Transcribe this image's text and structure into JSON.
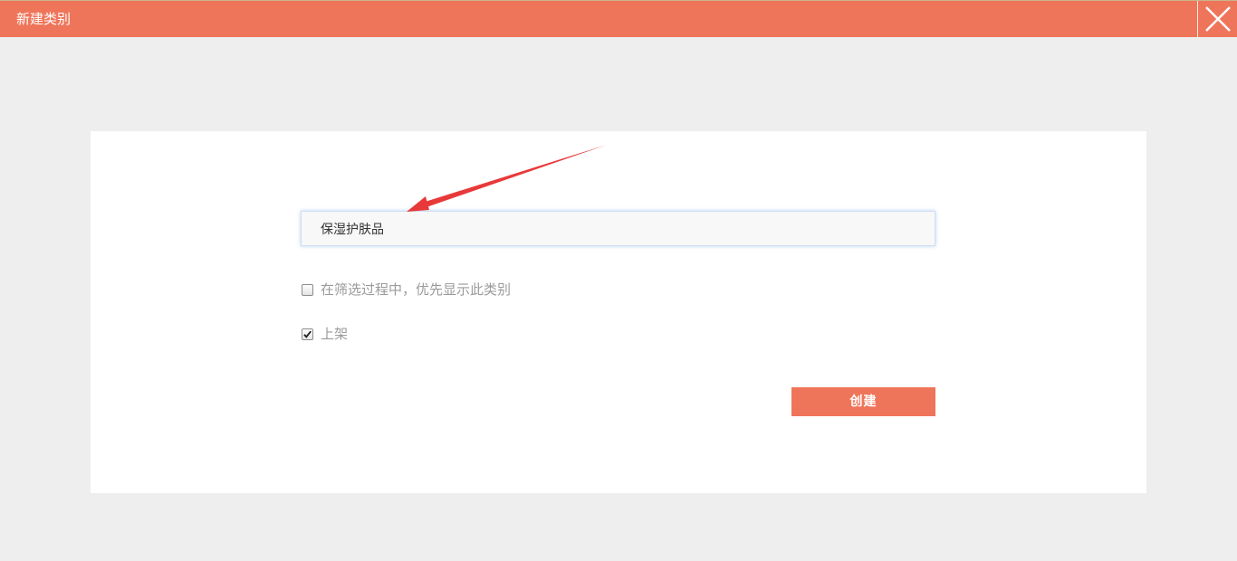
{
  "window": {
    "title": "新建类别",
    "close_icon": "close-icon",
    "accent_color": "#ef755a"
  },
  "form": {
    "category_name_value": "保湿护肤品",
    "options": [
      {
        "label": "在筛选过程中，优先显示此类别",
        "checked": false
      },
      {
        "label": "上架",
        "checked": true
      }
    ],
    "submit_label": "创建"
  },
  "annotation": {
    "arrow_color": "#e8393a"
  }
}
